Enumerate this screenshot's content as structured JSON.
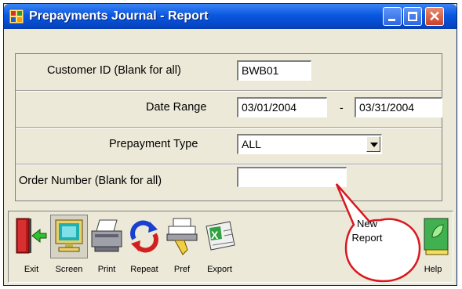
{
  "window": {
    "title": "Prepayments Journal - Report",
    "icons": [
      "app-icon",
      "minimize-icon",
      "maximize-icon",
      "close-icon"
    ]
  },
  "form": {
    "customer_label": "Customer ID (Blank for all)",
    "customer_value": "BWB01",
    "date_label": "Date Range",
    "date_from": "03/01/2004",
    "date_separator": "-",
    "date_to": "03/31/2004",
    "type_label": "Prepayment Type",
    "type_value": "ALL",
    "order_label": "Order Number  (Blank for all)",
    "order_value": ""
  },
  "toolbar": {
    "exit": "Exit",
    "screen": "Screen",
    "print": "Print",
    "repeat": "Repeat",
    "pref": "Pref",
    "export": "Export",
    "help": "Help"
  },
  "callout": {
    "line1": "New",
    "line2": "Report"
  },
  "colors": {
    "titlebar": "#0a58e0",
    "dialog_bg": "#ece9d8",
    "callout_border": "#d81820"
  }
}
